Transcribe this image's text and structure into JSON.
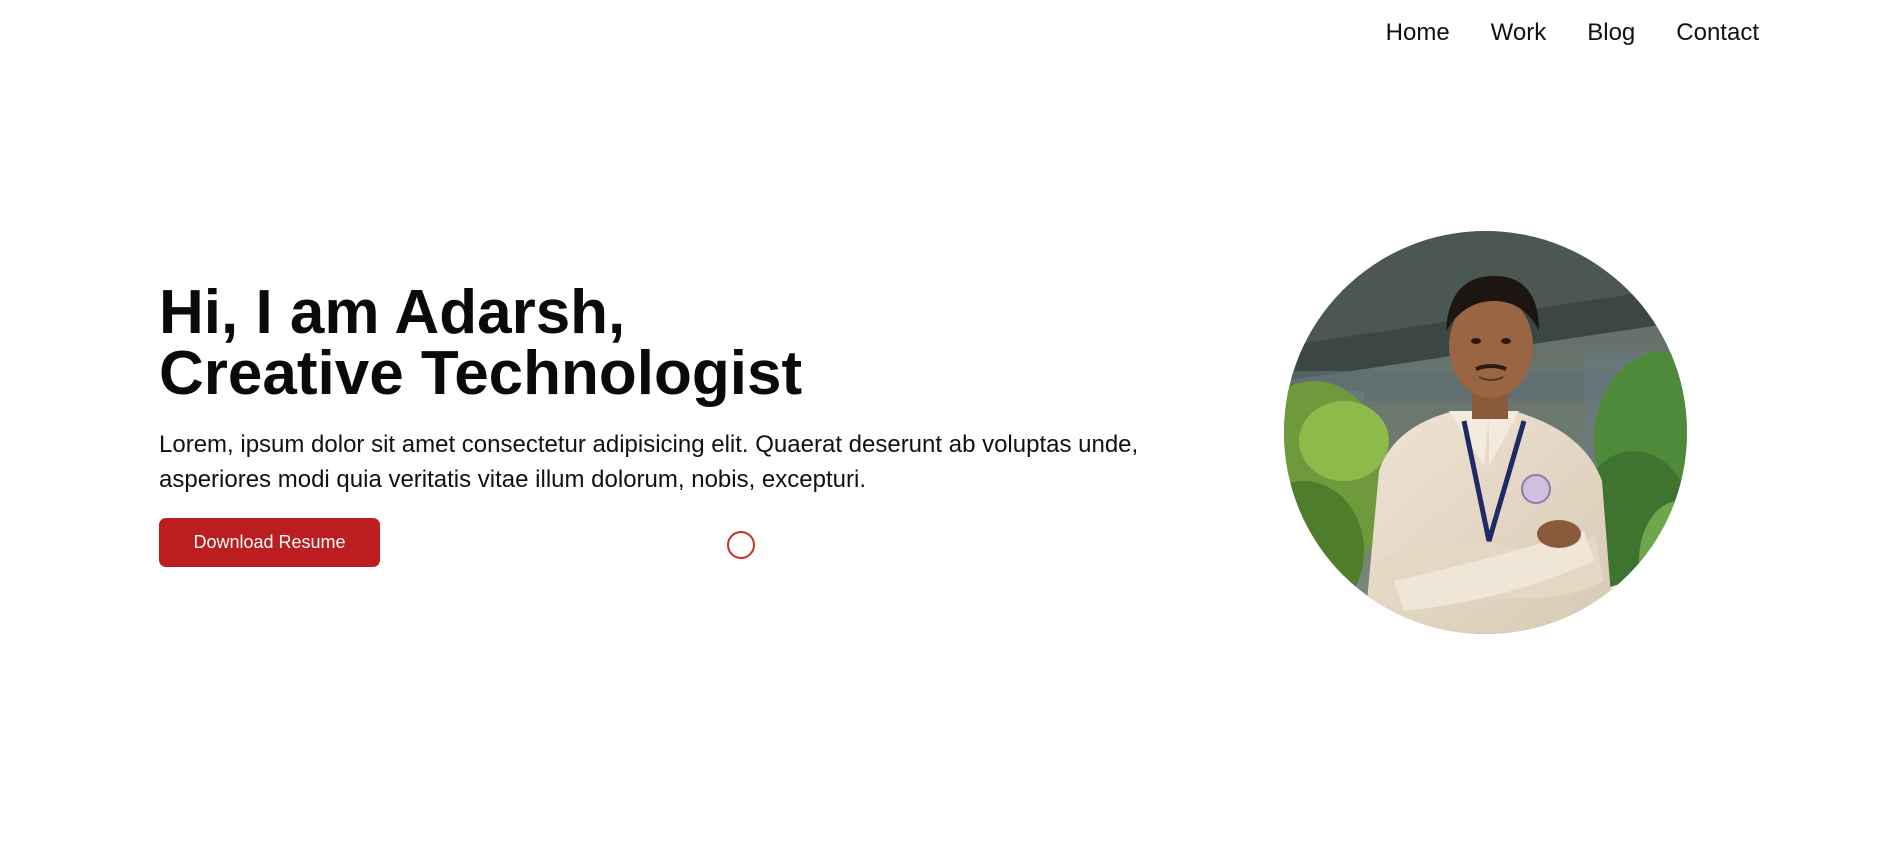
{
  "nav": {
    "items": [
      {
        "label": "Home"
      },
      {
        "label": "Work"
      },
      {
        "label": "Blog"
      },
      {
        "label": "Contact"
      }
    ]
  },
  "hero": {
    "title_line1": "Hi, I am Adarsh,",
    "title_line2": "Creative Technologist",
    "description": "Lorem, ipsum dolor sit amet consectetur adipisicing elit. Quaerat deserunt ab voluptas unde, asperiores modi quia veritatis vitae illum dolorum, nobis, excepturi.",
    "button_label": "Download Resume"
  },
  "colors": {
    "accent": "#bb1d20",
    "text": "#111111",
    "background": "#ffffff"
  },
  "icons": {
    "cursor": "cursor-ring-icon"
  }
}
